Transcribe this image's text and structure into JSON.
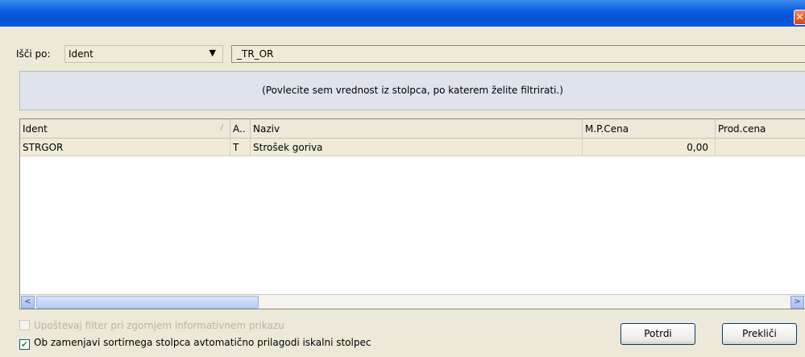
{
  "window": {
    "close_glyph": "✕"
  },
  "search": {
    "label": "Išči po:",
    "field_value": "Ident",
    "text_value": "_TR_OR",
    "arrow": "▼"
  },
  "group_panel": {
    "text": "(Povlecite sem vrednost iz stolpca, po katerem želite filtrirati.)"
  },
  "grid": {
    "columns": [
      {
        "label": "Ident"
      },
      {
        "label": "A.."
      },
      {
        "label": "Naziv"
      },
      {
        "label": "M.P.Cena"
      },
      {
        "label": "Prod.cena"
      }
    ],
    "sort_glyph": "/",
    "rows": [
      {
        "ident": "STRGOR",
        "a": "T",
        "naziv": "Strošek goriva",
        "mp_cena": "0,00",
        "prod_cena": ""
      }
    ]
  },
  "scrollbar": {
    "left_arrow": "<",
    "right_arrow": ">"
  },
  "options": {
    "filter_label": "Upoštevaj filter pri zgornjem informativnem prikazu",
    "filter_checked": false,
    "filter_enabled": false,
    "autoadjust_label": "Ob zamenjavi sortirnega stolpca avtomatično prilagodi iskalni stolpec",
    "autoadjust_checked": true,
    "check_glyph": "✔"
  },
  "buttons": {
    "confirm": "Potrdi",
    "cancel": "Prekliči"
  }
}
